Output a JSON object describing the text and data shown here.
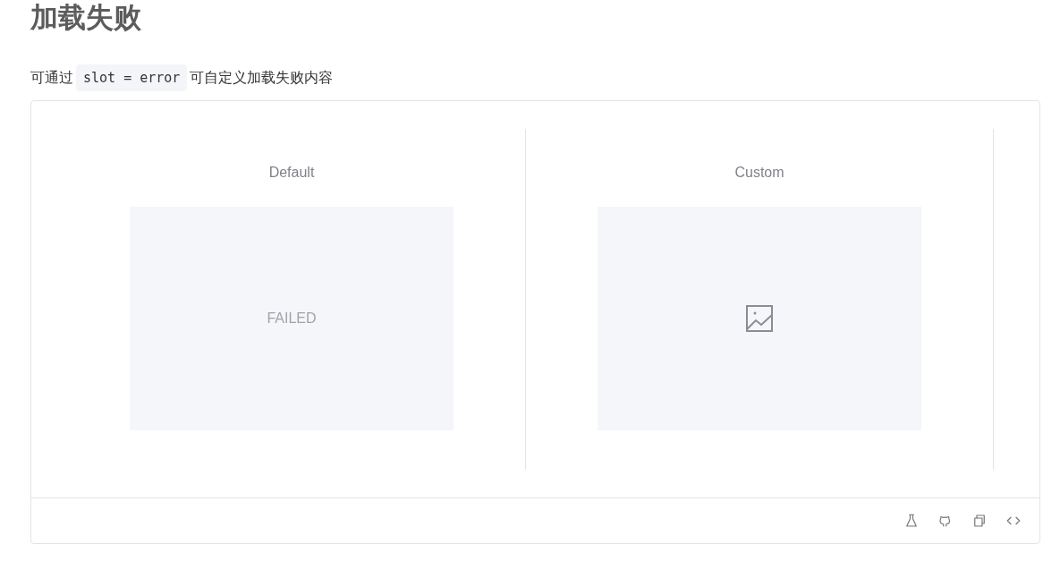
{
  "heading": "加载失败",
  "intro": {
    "before": "可通过",
    "code": "slot = error",
    "after": "可自定义加载失败内容"
  },
  "demos": [
    {
      "label": "Default",
      "kind": "text",
      "text": "FAILED"
    },
    {
      "label": "Custom",
      "kind": "icon"
    }
  ]
}
